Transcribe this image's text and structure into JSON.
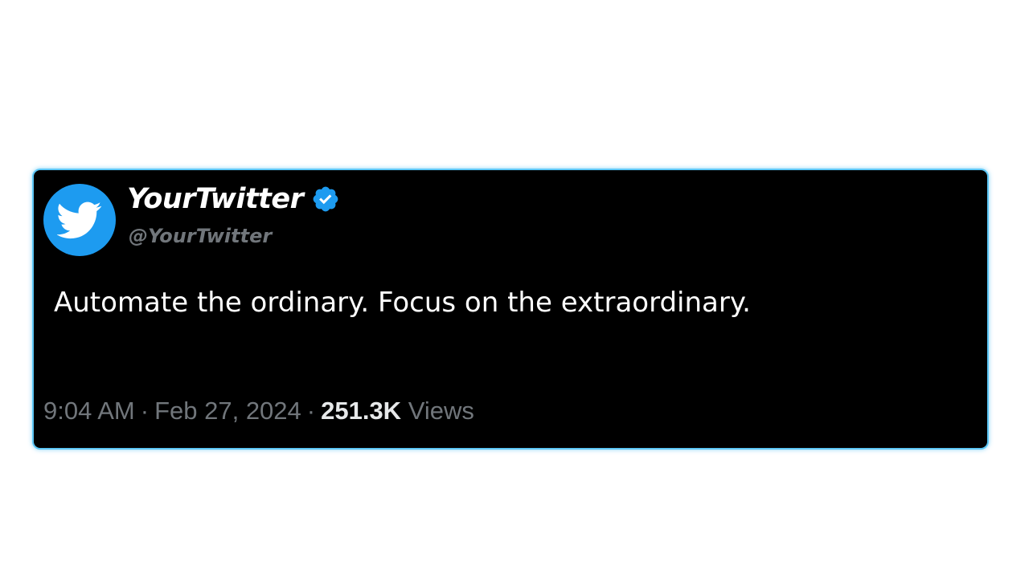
{
  "tweet": {
    "display_name": "YourTwitter",
    "handle": "@YourTwitter",
    "text": "Automate the ordinary. Focus on the extraordinary.",
    "time": "9:04 AM",
    "date": "Feb 27, 2024",
    "separator": "·",
    "views_count": "251.3K",
    "views_label": "Views",
    "verified": true,
    "avatar_icon": "twitter-bird-icon",
    "badge_icon": "verified-badge-icon"
  },
  "colors": {
    "card_background": "#000000",
    "card_border_glow": "#5cc6f5",
    "accent_blue": "#1d9bf0",
    "secondary_text": "#71767b",
    "primary_text": "#ffffff"
  }
}
